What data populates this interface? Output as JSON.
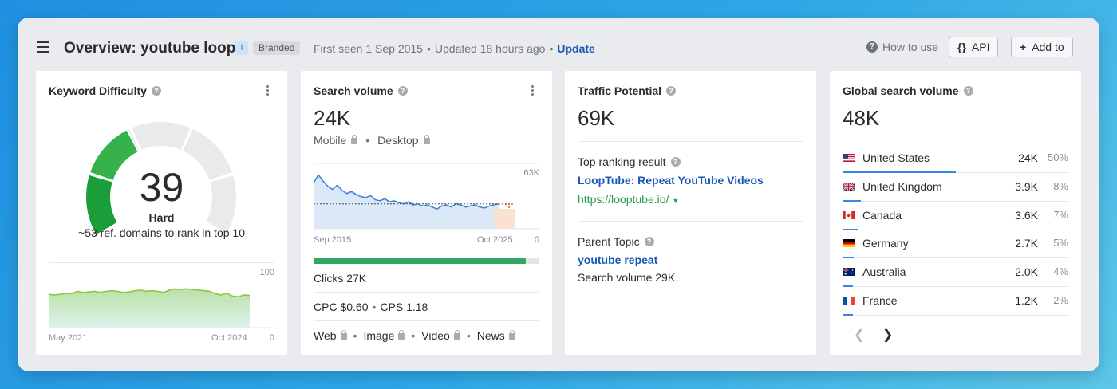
{
  "header": {
    "title": "Overview: youtube loop",
    "intent_badge": "I",
    "branded_badge": "Branded",
    "first_seen": "First seen 1 Sep 2015",
    "updated": "Updated 18 hours ago",
    "update_link": "Update",
    "how_to_use": "How to use",
    "api_label": "API",
    "add_to_label": "Add to"
  },
  "colors": {
    "accent": "#1a58b8",
    "difficulty_green": "#2fa84a",
    "clicks_bar": "#2fa866",
    "url_green": "#2a9a4c"
  },
  "keyword_difficulty": {
    "title": "Keyword Difficulty",
    "score": "39",
    "score_value": 39,
    "label": "Hard",
    "description": "~53 ref. domains to rank in top 10",
    "axis_max": "100",
    "axis_min": "0",
    "x_start": "May 2021",
    "x_end": "Oct 2024",
    "history": [
      55,
      54,
      55,
      57,
      56,
      60,
      58,
      59,
      60,
      58,
      60,
      61,
      60,
      58,
      59,
      61,
      62,
      60,
      61,
      60,
      58,
      62,
      64,
      63,
      64,
      63,
      62,
      61,
      60,
      56,
      54,
      57,
      52,
      51,
      54,
      53
    ]
  },
  "search_volume": {
    "title": "Search volume",
    "value": "24K",
    "device_mobile": "Mobile",
    "device_desktop": "Desktop",
    "axis_max": "63K",
    "axis_min": "0",
    "x_start": "Sep 2015",
    "x_end": "Oct 2025",
    "history": [
      44,
      52,
      46,
      41,
      38,
      42,
      37,
      34,
      36,
      33,
      31,
      30,
      32,
      28,
      27,
      29,
      26,
      27,
      25,
      24,
      26,
      23,
      24,
      22,
      23,
      21,
      19,
      22,
      23,
      21,
      24,
      23,
      21,
      22,
      23,
      21,
      20,
      22,
      23,
      24
    ],
    "clicks_fraction": 0.94,
    "clicks": "Clicks 27K",
    "cpc": "CPC $0.60",
    "cps": "CPS 1.18",
    "serp_features": [
      "Web",
      "Image",
      "Video",
      "News"
    ]
  },
  "traffic_potential": {
    "title": "Traffic Potential",
    "value": "69K",
    "top_ranking_label": "Top ranking result",
    "top_result_title": "LoopTube: Repeat YouTube Videos",
    "top_result_url": "https://looptube.io/",
    "parent_topic_label": "Parent Topic",
    "parent_topic": "youtube repeat",
    "parent_volume": "Search volume 29K"
  },
  "global_volume": {
    "title": "Global search volume",
    "value": "48K",
    "countries": [
      {
        "name": "United States",
        "value": "24K",
        "pct": "50%",
        "share": 0.5,
        "flag": "us"
      },
      {
        "name": "United Kingdom",
        "value": "3.9K",
        "pct": "8%",
        "share": 0.08,
        "flag": "gb"
      },
      {
        "name": "Canada",
        "value": "3.6K",
        "pct": "7%",
        "share": 0.07,
        "flag": "ca"
      },
      {
        "name": "Germany",
        "value": "2.7K",
        "pct": "5%",
        "share": 0.05,
        "flag": "de"
      },
      {
        "name": "Australia",
        "value": "2.0K",
        "pct": "4%",
        "share": 0.04,
        "flag": "au"
      },
      {
        "name": "France",
        "value": "1.2K",
        "pct": "2%",
        "share": 0.02,
        "flag": "fr"
      }
    ],
    "prev_icon": "chevron-left-icon",
    "next_icon": "chevron-right-icon"
  }
}
